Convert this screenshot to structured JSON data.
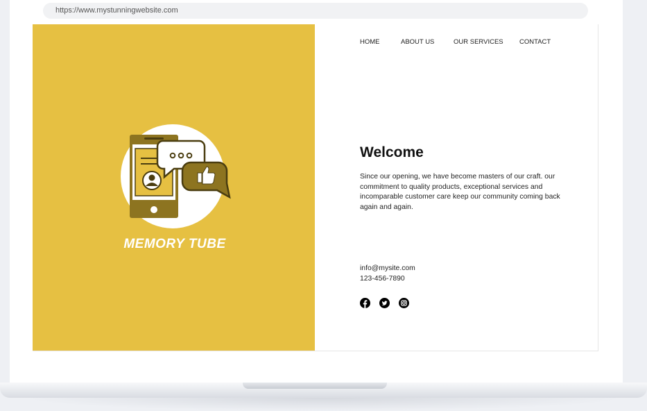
{
  "browser": {
    "url": "https://www.mystunningwebsite.com"
  },
  "site": {
    "brand_name": "MEMORY TUBE",
    "nav": {
      "home": "HOME",
      "about": "ABOUT US",
      "services": "OUR SERVICES",
      "contact": "CONTACT"
    },
    "welcome": {
      "title": "Welcome",
      "text": "Since our opening, we have become masters of our craft. our commitment to quality products, exceptional services and incomparable customer care keep our community coming back again and again."
    },
    "contact": {
      "email": "info@mysite.com",
      "phone": "123-456-7890"
    },
    "social_icons": [
      "facebook-icon",
      "twitter-icon",
      "instagram-icon"
    ]
  },
  "colors": {
    "hero_yellow": "#e6c042",
    "icon_olive": "#8d7420",
    "text_dark": "#222222"
  }
}
